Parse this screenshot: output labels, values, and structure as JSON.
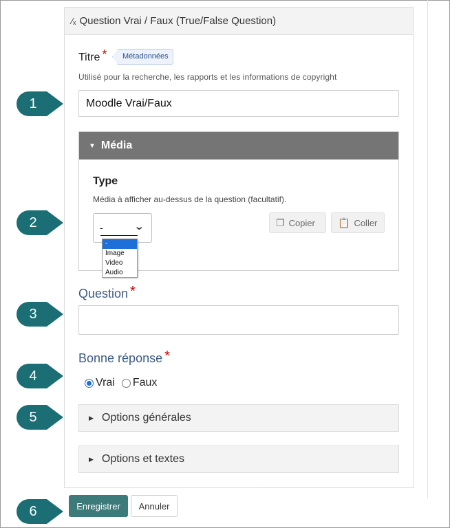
{
  "panel": {
    "header_icon": "checkmark-x-icon",
    "header_icon_glyph": "⁄ₓ",
    "header_title": "Question Vrai / Faux (True/False Question)"
  },
  "title_field": {
    "label": "Titre",
    "required_mark": "*",
    "badge": "Métadonnées",
    "help": "Utilisé pour la recherche, les rapports et les informations de copyright",
    "value": "Moodle Vrai/Faux"
  },
  "media": {
    "header": "Média",
    "type_label": "Type",
    "type_help": "Média à afficher au-dessus de la question (facultatif).",
    "selected": "-",
    "options": [
      "-",
      "Image",
      "Video",
      "Audio"
    ],
    "copy_label": "Copier",
    "paste_label": "Coller"
  },
  "question": {
    "label": "Question",
    "required_mark": "*",
    "value": ""
  },
  "answer": {
    "label": "Bonne réponse",
    "required_mark": "*",
    "options": [
      {
        "label": "Vrai",
        "checked": true
      },
      {
        "label": "Faux",
        "checked": false
      }
    ]
  },
  "sections": [
    "Options générales",
    "Options et textes"
  ],
  "footer": {
    "save_label": "Enregistrer",
    "cancel_label": "Annuler"
  },
  "callouts": [
    "1",
    "2",
    "3",
    "4",
    "5",
    "6"
  ],
  "colors": {
    "callout": "#1a6e74",
    "accent": "#3d7a7a",
    "section_label": "#3c5a84",
    "media_header": "#757575",
    "required": "#cc0000",
    "radio": "#1e6fd9"
  }
}
